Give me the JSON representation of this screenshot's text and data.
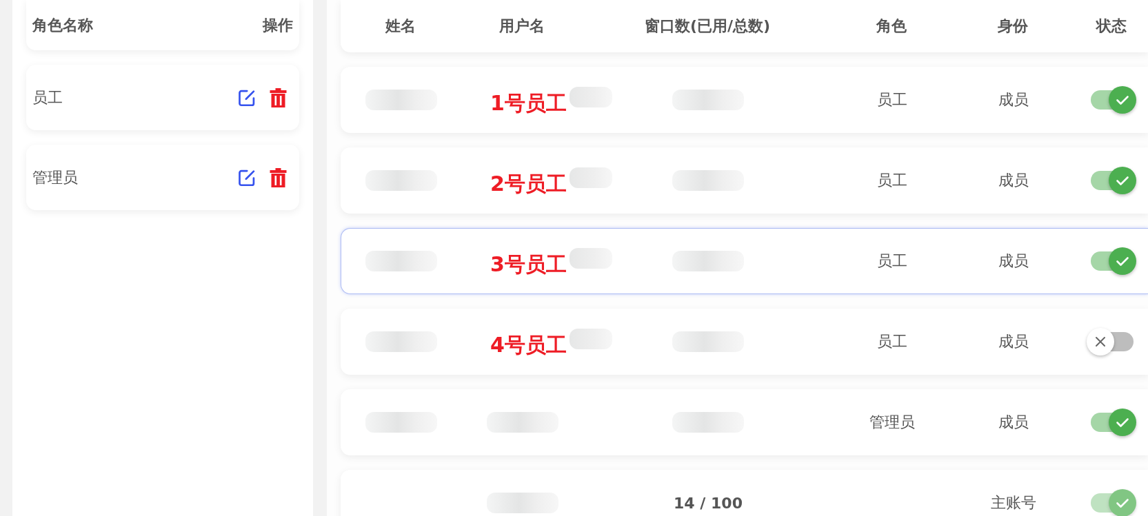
{
  "roles_panel": {
    "columns": [
      "角色名称",
      "操作"
    ],
    "roles": [
      {
        "name": "员工"
      },
      {
        "name": "管理员"
      }
    ]
  },
  "users_table": {
    "columns": [
      "姓名",
      "用户名",
      "窗口数(已用/总数)",
      "角色",
      "身份",
      "状态"
    ],
    "rows": [
      {
        "selected": false,
        "name": {
          "kind": "redacted"
        },
        "username": {
          "kind": "redacted"
        },
        "windows": {
          "kind": "redacted"
        },
        "role": "员工",
        "identity": "成员",
        "on": true,
        "disabled": false,
        "annotation": "1号员工"
      },
      {
        "selected": false,
        "name": {
          "kind": "redacted"
        },
        "username": {
          "kind": "redacted"
        },
        "windows": {
          "kind": "redacted"
        },
        "role": "员工",
        "identity": "成员",
        "on": true,
        "disabled": false,
        "annotation": "2号员工"
      },
      {
        "selected": true,
        "name": {
          "kind": "redacted"
        },
        "username": {
          "kind": "redacted"
        },
        "windows": {
          "kind": "redacted"
        },
        "role": "员工",
        "identity": "成员",
        "on": true,
        "disabled": false,
        "annotation": "3号员工"
      },
      {
        "selected": false,
        "name": {
          "kind": "redacted"
        },
        "username": {
          "kind": "redacted"
        },
        "windows": {
          "kind": "redacted"
        },
        "role": "员工",
        "identity": "成员",
        "on": false,
        "disabled": false,
        "annotation": "4号员工"
      },
      {
        "selected": false,
        "name": {
          "kind": "redacted"
        },
        "username": {
          "kind": "redacted"
        },
        "windows": {
          "kind": "redacted"
        },
        "role": "管理员",
        "identity": "成员",
        "on": true,
        "disabled": false
      },
      {
        "selected": false,
        "username": {
          "kind": "redacted"
        },
        "windows": {
          "kind": "text",
          "text": "14 / 100"
        },
        "identity": "主账号",
        "on": true,
        "disabled": true
      }
    ]
  }
}
